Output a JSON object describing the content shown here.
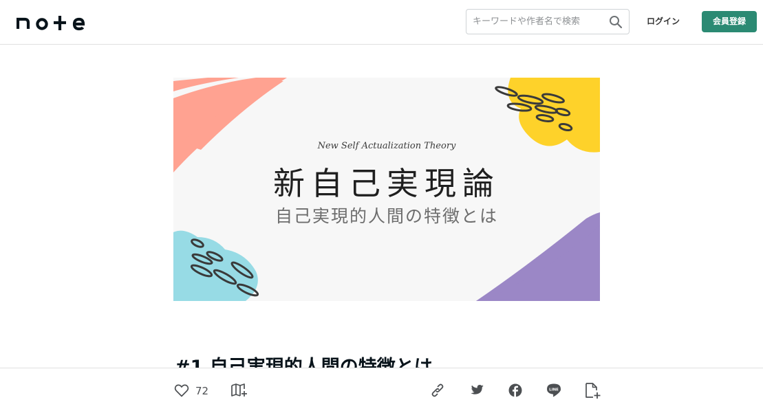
{
  "header": {
    "logo_text": "note",
    "search_placeholder": "キーワードや作者名で検索",
    "login_label": "ログイン",
    "signup_label": "会員登録",
    "accent_color": "#2b8a73"
  },
  "hero": {
    "subtitle_en": "New Self Actualization Theory",
    "title": "新自己実現論",
    "subtitle_jp": "自己実現的人間の特徴とは",
    "colors": {
      "salmon": "#ffa291",
      "yellow": "#fed22a",
      "cyan": "#97dbe5",
      "purple": "#9b87c6"
    }
  },
  "article": {
    "title": "#1 自己実現的人間の特徴とは"
  },
  "action_bar": {
    "like_count": "72",
    "icons": [
      "heart-icon",
      "magazine-add-icon",
      "link-icon",
      "twitter-icon",
      "facebook-icon",
      "line-icon",
      "embed-icon"
    ],
    "line_text": "LINE"
  }
}
